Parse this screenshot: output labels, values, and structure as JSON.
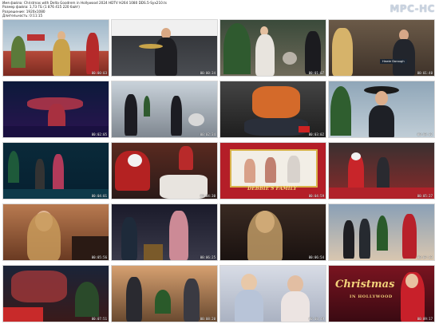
{
  "header": {
    "lines": [
      "Имя файла: Christmas with Delta Goodrem in Hollywood 2024 HDTV H264 1080 DDS.5-Syx210.ts",
      "Размер файла: 1,73 ГБ (1 876 415 220 байт)",
      "Разрешение: 1920x1080",
      "Длительность: 0:11:15"
    ],
    "logo": "MPC-HC"
  },
  "thumbnails": [
    {
      "time": "00:00:03"
    },
    {
      "time": "00:00:34"
    },
    {
      "time": "00:01:07"
    },
    {
      "time": "00:01:40"
    },
    {
      "time": "00:02:05"
    },
    {
      "time": "00:02:34"
    },
    {
      "time": "00:03:02"
    },
    {
      "time": "00:03:32"
    },
    {
      "time": "00:04:01"
    },
    {
      "time": "00:04:30"
    },
    {
      "time": "00:04:59"
    },
    {
      "time": "00:05:27"
    },
    {
      "time": "00:05:56"
    },
    {
      "time": "00:06:25"
    },
    {
      "time": "00:06:54"
    },
    {
      "time": "00:07:23"
    },
    {
      "time": "00:07:51"
    },
    {
      "time": "00:08:20"
    },
    {
      "time": "00:08:49"
    },
    {
      "time": "00:09:17"
    }
  ],
  "overlays": {
    "nametag": "Hewie Dorough",
    "banner": "DEBBIE'S FAMILY",
    "title_line1": "Christmas",
    "title_line2": "IN HOLLYWOOD"
  }
}
